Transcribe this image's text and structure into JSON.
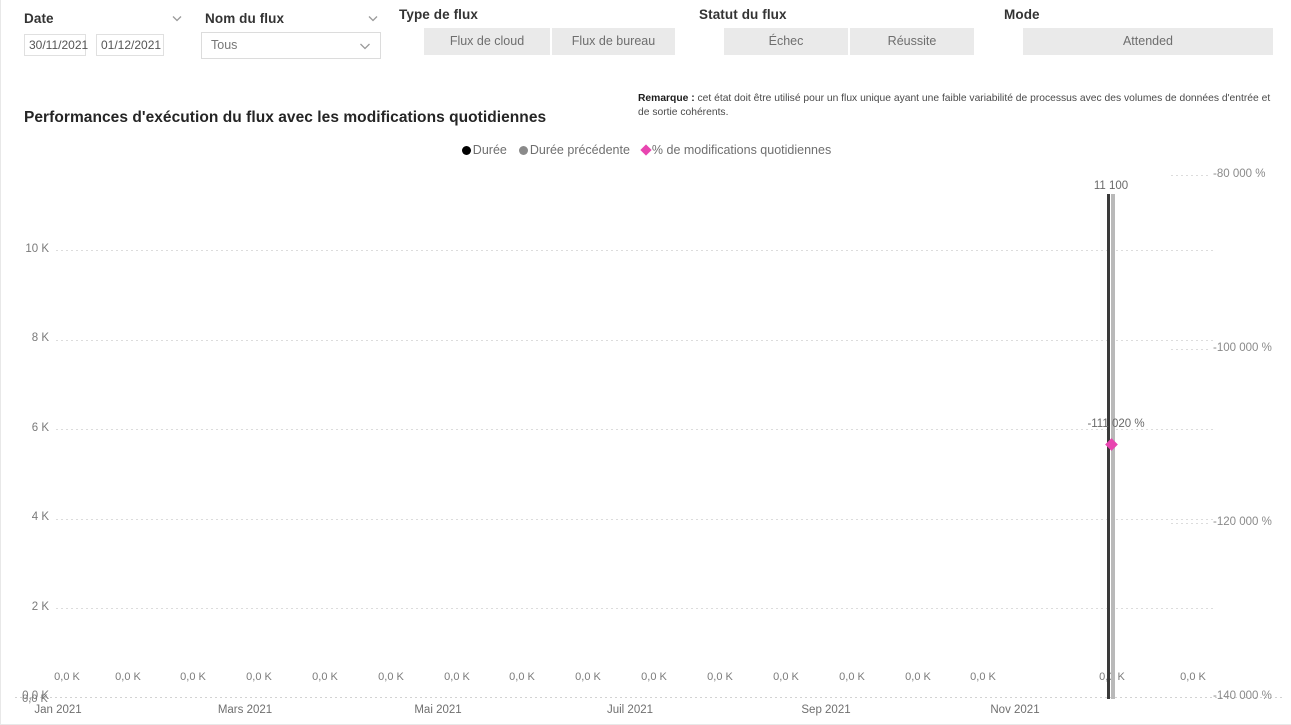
{
  "filters": {
    "date": {
      "label": "Date",
      "chevron_icon": "chevron-down-icon",
      "start": "30/11/2021",
      "end": "01/12/2021"
    },
    "flow_name": {
      "label": "Nom du flux",
      "chevron_icon": "chevron-down-icon",
      "selected": "Tous"
    },
    "flow_type": {
      "label": "Type de flux",
      "options": [
        "Flux de cloud",
        "Flux de bureau"
      ]
    },
    "flow_status": {
      "label": "Statut du flux",
      "options": [
        "Échec",
        "Réussite"
      ]
    },
    "mode": {
      "label": "Mode",
      "options": [
        "Attended"
      ]
    }
  },
  "headings": {
    "chart_title": "Performances d'exécution du flux avec les modifications quotidiennes",
    "note_prefix": "Remarque :",
    "note_body": " cet état doit être utilisé pour un flux unique ayant une faible variabilité de processus avec des volumes de données d'entrée et de sortie cohérents."
  },
  "colors": {
    "duree": "#000000",
    "duree_precedente": "#8a8a8a",
    "pct_modifications": "#e845b0",
    "tile_bg": "#eaeaea",
    "grid": "#dcdcdc"
  },
  "chart_data": {
    "type": "bar",
    "title": "Performances d'exécution du flux avec les modifications quotidiennes",
    "xlabel": "",
    "ylabel": "",
    "grid": true,
    "legend_position": "top-center",
    "legend": [
      {
        "name": "Durée",
        "marker": "circle",
        "color": "#000000"
      },
      {
        "name": "Durée précédente",
        "marker": "circle",
        "color": "#8a8a8a"
      },
      {
        "name": "% de modifications quotidiennes",
        "marker": "diamond",
        "color": "#e845b0"
      }
    ],
    "y_left": {
      "ticks": [
        "10 K",
        "8 K",
        "6 K",
        "4 K",
        "2 K",
        "0,0 K"
      ],
      "values": [
        10000,
        8000,
        6000,
        4000,
        2000,
        0
      ],
      "ylim": [
        0,
        11500
      ]
    },
    "y_right": {
      "ticks": [
        "-80 000 %",
        "-100 000 %",
        "-120 000 %",
        "-140 000 %"
      ],
      "values": [
        -80000,
        -100000,
        -120000,
        -140000
      ],
      "ylim": [
        -145000,
        -76000
      ]
    },
    "x_axis_labels": [
      "Jan 2021",
      "Mars 2021",
      "Mai 2021",
      "Juil 2021",
      "Sep 2021",
      "Nov 2021"
    ],
    "data_labels": [
      "0,0 K",
      "0,0 K",
      "0,0 K",
      "0,0 K",
      "0,0 K",
      "0,0 K",
      "0,0 K",
      "0,0 K",
      "0,0 K",
      "0,0 K",
      "0,0 K",
      "0,0 K",
      "0,0 K",
      "0,0 K",
      "0,0 K",
      "0,0 K",
      "0,0 K",
      "0,0 K"
    ],
    "axis_origin_label": "0,0 K",
    "highlight": {
      "duree_label": "11 100",
      "duree_value": 11100,
      "duree_precedente_value": 11100,
      "pct_label": "-111 020 %",
      "pct_value": -111020
    },
    "series": [
      {
        "name": "Durée",
        "color": "#000000",
        "values": [
          0,
          0,
          0,
          0,
          0,
          0,
          0,
          0,
          0,
          0,
          0,
          0,
          0,
          0,
          0,
          0,
          11100,
          0
        ]
      },
      {
        "name": "Durée précédente",
        "color": "#8a8a8a",
        "values": [
          0,
          0,
          0,
          0,
          0,
          0,
          0,
          0,
          0,
          0,
          0,
          0,
          0,
          0,
          0,
          0,
          11100,
          0
        ]
      },
      {
        "name": "% de modifications quotidiennes",
        "color": "#e845b0",
        "values": [
          null,
          null,
          null,
          null,
          null,
          null,
          null,
          null,
          null,
          null,
          null,
          null,
          null,
          null,
          null,
          null,
          -111020,
          null
        ]
      }
    ]
  }
}
